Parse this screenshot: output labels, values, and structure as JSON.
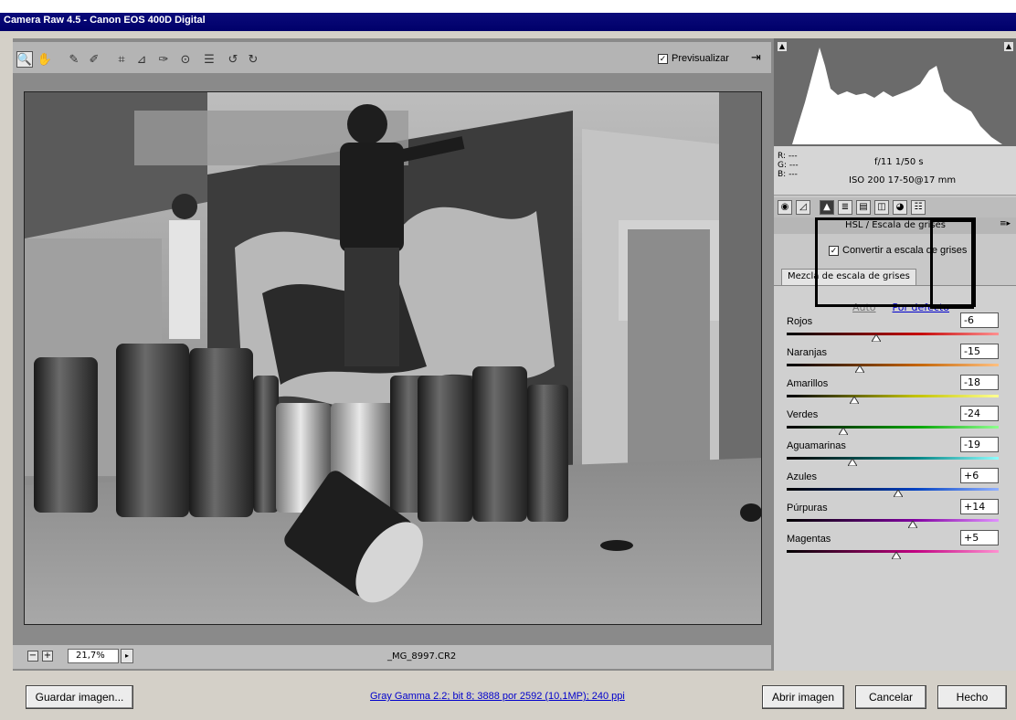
{
  "window": {
    "title": "Camera Raw 4.5 -  Canon EOS 400D Digital"
  },
  "toolbar": {
    "tools": [
      "zoom-icon",
      "hand-icon",
      "eyedropper-icon",
      "color-sampler-icon",
      "crop-icon",
      "straighten-icon",
      "retouch-icon",
      "redeye-icon",
      "list-icon",
      "rotate-ccw-icon",
      "rotate-cw-icon"
    ],
    "preview_label": "Previsualizar",
    "preview_checked": "✓"
  },
  "zoom": {
    "value": "21,7%"
  },
  "file": {
    "name": "_MG_8997.CR2"
  },
  "info": {
    "r": "R:  ---",
    "g": "G:  ---",
    "b": "B:  ---",
    "exif_aperture_shutter": "f/11   1/50 s",
    "exif_iso_lens": "ISO 200   17-50@17 mm"
  },
  "panel": {
    "title": "HSL / Escala de grises",
    "convert_label": "Convertir a escala de grises",
    "convert_check": "✓",
    "mix_tab": "Mezcla de escala de grises",
    "auto_label": "Auto",
    "default_label": "Por defecto",
    "sliders": [
      {
        "label": "Rojos",
        "value": "-6",
        "level": -6,
        "track": "#a00000,#f0f0f0,#ff8080"
      },
      {
        "label": "Naranjas",
        "value": "-15",
        "level": -15
      },
      {
        "label": "Amarillos",
        "value": "-18",
        "level": -18
      },
      {
        "label": "Verdes",
        "value": "-24",
        "level": -24
      },
      {
        "label": "Aguamarinas",
        "value": "-19",
        "level": -19
      },
      {
        "label": "Azules",
        "value": "+6",
        "level": 6
      },
      {
        "label": "Púrpuras",
        "value": "+14",
        "level": 14
      },
      {
        "label": "Magentas",
        "value": "+5",
        "level": 5
      }
    ]
  },
  "footer": {
    "save_label": "Guardar imagen...",
    "status_link": "Gray Gamma 2.2; bit 8; 3888 por 2592 (10,1MP); 240 ppi",
    "open_label": "Abrir imagen",
    "cancel_label": "Cancelar",
    "done_label": "Hecho"
  },
  "colors": {
    "title_bar": "#00006a",
    "link": "#0000cc",
    "highlight_box": "#000000"
  }
}
